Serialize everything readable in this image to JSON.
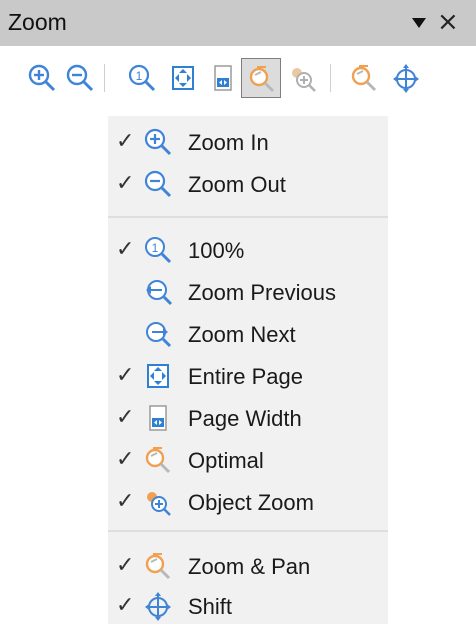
{
  "panel": {
    "title": "Zoom"
  },
  "toolbar": {
    "buttons": [
      {
        "name": "zoom-in",
        "icon": "zoom-in-icon"
      },
      {
        "name": "zoom-out",
        "icon": "zoom-out-icon"
      },
      {
        "name": "zoom-100",
        "icon": "zoom-100-icon"
      },
      {
        "name": "entire-page",
        "icon": "entire-page-icon"
      },
      {
        "name": "page-width",
        "icon": "page-width-icon"
      },
      {
        "name": "optimal",
        "icon": "optimal-zoom-icon",
        "active": true
      },
      {
        "name": "object-zoom",
        "icon": "object-zoom-icon",
        "disabled": true
      },
      {
        "name": "zoom-pan",
        "icon": "zoom-pan-icon"
      },
      {
        "name": "shift",
        "icon": "shift-icon"
      }
    ]
  },
  "menu": {
    "groups": [
      [
        {
          "label": "Zoom In",
          "checked": true,
          "icon": "zoom-in-icon"
        },
        {
          "label": "Zoom Out",
          "checked": true,
          "icon": "zoom-out-icon"
        }
      ],
      [
        {
          "label": "100%",
          "checked": true,
          "icon": "zoom-100-icon"
        },
        {
          "label": "Zoom Previous",
          "checked": false,
          "icon": "zoom-previous-icon"
        },
        {
          "label": "Zoom Next",
          "checked": false,
          "icon": "zoom-next-icon"
        },
        {
          "label": "Entire Page",
          "checked": true,
          "icon": "entire-page-icon"
        },
        {
          "label": "Page Width",
          "checked": true,
          "icon": "page-width-icon"
        },
        {
          "label": "Optimal",
          "checked": true,
          "icon": "optimal-zoom-icon"
        },
        {
          "label": "Object Zoom",
          "checked": true,
          "icon": "object-zoom-icon"
        }
      ],
      [
        {
          "label": "Zoom & Pan",
          "checked": true,
          "icon": "zoom-pan-icon"
        },
        {
          "label": "Shift",
          "checked": true,
          "icon": "shift-icon"
        }
      ]
    ],
    "check_glyph": "✓"
  },
  "colors": {
    "titlebar": "#c9c9c9",
    "menu_bg": "#f1f1f1",
    "icon_blue": "#2f7fd3",
    "icon_orange": "#f0a050",
    "icon_gray": "#888888"
  }
}
